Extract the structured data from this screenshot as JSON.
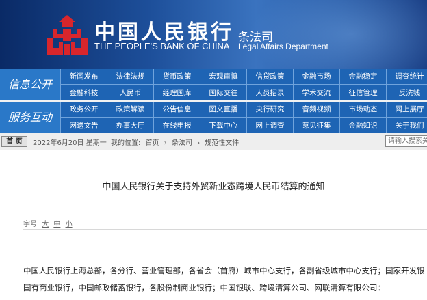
{
  "header": {
    "bank_cn": "中国人民银行",
    "bank_en": "THE PEOPLE'S BANK OF CHINA",
    "dept_cn": "条法司",
    "dept_en": "Legal Affairs Department",
    "logo_icon": "pboc-logo-icon",
    "colors": {
      "banner": "#1d4f9a",
      "nav": "#1e64b4",
      "logo": "#d8262c"
    }
  },
  "nav": {
    "group1": {
      "title": "信息公开",
      "row1": [
        "新闻发布",
        "法律法规",
        "货币政策",
        "宏观审慎",
        "信贷政策",
        "金融市场",
        "金融稳定",
        "调查统计"
      ],
      "row2": [
        "金融科技",
        "人民币",
        "经理国库",
        "国际交往",
        "人员招录",
        "学术交流",
        "征信管理",
        "反洗钱"
      ]
    },
    "group2": {
      "title": "服务互动",
      "row1": [
        "政务公开",
        "政策解读",
        "公告信息",
        "图文直播",
        "央行研究",
        "音频视频",
        "市场动态",
        "网上展厅"
      ],
      "row2": [
        "网送文告",
        "办事大厅",
        "在线申报",
        "下载中心",
        "网上调查",
        "意见征集",
        "金融知识",
        "关于我们"
      ]
    }
  },
  "breadcrumb": {
    "home": "首 页",
    "date": "2022年6月20日 星期一",
    "location_label": "我的位置:",
    "items": [
      "首页",
      "条法司",
      "规范性文件"
    ],
    "separator": "›",
    "search_placeholder": "请输入搜索关"
  },
  "article": {
    "title": "中国人民银行关于支持外贸新业态跨境人民币结算的通知",
    "fontsize_label": "字号",
    "fontsize_options": [
      "大",
      "中",
      "小"
    ],
    "paragraph1": "中国人民银行上海总部，各分行、营业管理部，各省会（首府）城市中心支行，各副省级城市中心支行；国家开发银",
    "paragraph2": "国有商业银行，中国邮政储蓄银行，各股份制商业银行；中国银联、跨境清算公司、网联清算有限公司："
  }
}
